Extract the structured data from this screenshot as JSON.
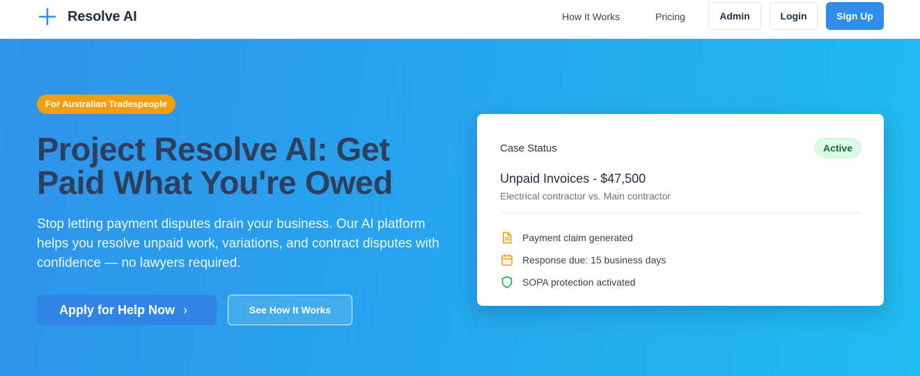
{
  "nav": {
    "brand": "Resolve AI",
    "links": [
      "How It Works",
      "Pricing"
    ],
    "admin": "Admin",
    "login": "Login",
    "signup": "Sign Up"
  },
  "hero": {
    "badge": "For Australian Tradespeople",
    "headline": "Project Resolve AI: Get Paid What You're Owed",
    "subtext": "Stop letting payment disputes drain your business. Our AI platform helps you resolve unpaid work, variations, and contract disputes with confidence — no lawyers required.",
    "cta_primary": "Apply for Help Now",
    "cta_primary_chevron": "›",
    "cta_secondary": "See How It Works"
  },
  "case_card": {
    "title": "Case Status",
    "status": "Active",
    "heading": "Unpaid Invoices - $47,500",
    "subheading": "Electrical contractor vs. Main contractor",
    "items": [
      {
        "icon": "document-icon",
        "label": "Payment claim generated"
      },
      {
        "icon": "calendar-icon",
        "label": "Response due: 15 business days"
      },
      {
        "icon": "shield-icon",
        "label": "SOPA protection activated"
      }
    ]
  },
  "colors": {
    "brand_blue": "#2f8ceb",
    "badge_orange": "#f59e0b",
    "heading_navy": "#2e3e5c",
    "status_green_bg": "#dcfce7",
    "status_green_text": "#166534",
    "icon_orange": "#f59e0b",
    "icon_green": "#16a34a"
  }
}
